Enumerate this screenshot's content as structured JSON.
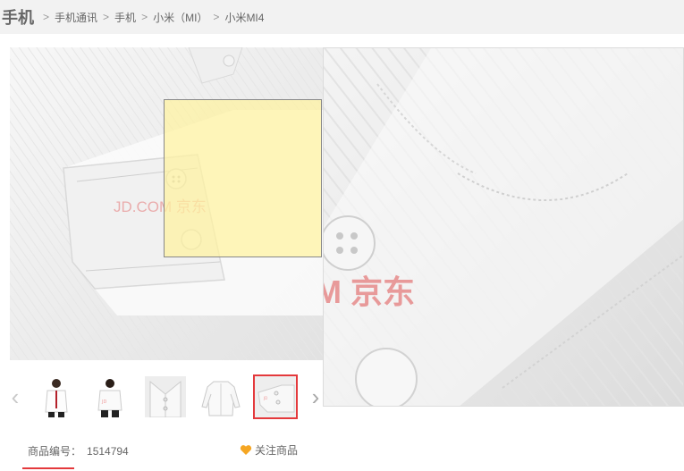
{
  "breadcrumb": {
    "root": "手机",
    "items": [
      "手机通讯",
      "手机",
      "小米（MI）",
      "小米MI4"
    ]
  },
  "main_image": {
    "watermark": "JD.COM 京东"
  },
  "zoom_view": {
    "watermark": "M 京东"
  },
  "thumbnails": {
    "prev_icon": "chevron-left-icon",
    "next_icon": "chevron-right-icon",
    "items": [
      {
        "name": "thumb-model-front"
      },
      {
        "name": "thumb-model-back"
      },
      {
        "name": "thumb-collar"
      },
      {
        "name": "thumb-shirt-full"
      },
      {
        "name": "thumb-sleeve-cuff",
        "selected": true
      }
    ]
  },
  "product": {
    "sku_label": "商品编号：",
    "sku_value": "1514794",
    "follow_label": "关注商品"
  },
  "colors": {
    "accent": "#e4393c",
    "heart": "#f5a623"
  }
}
